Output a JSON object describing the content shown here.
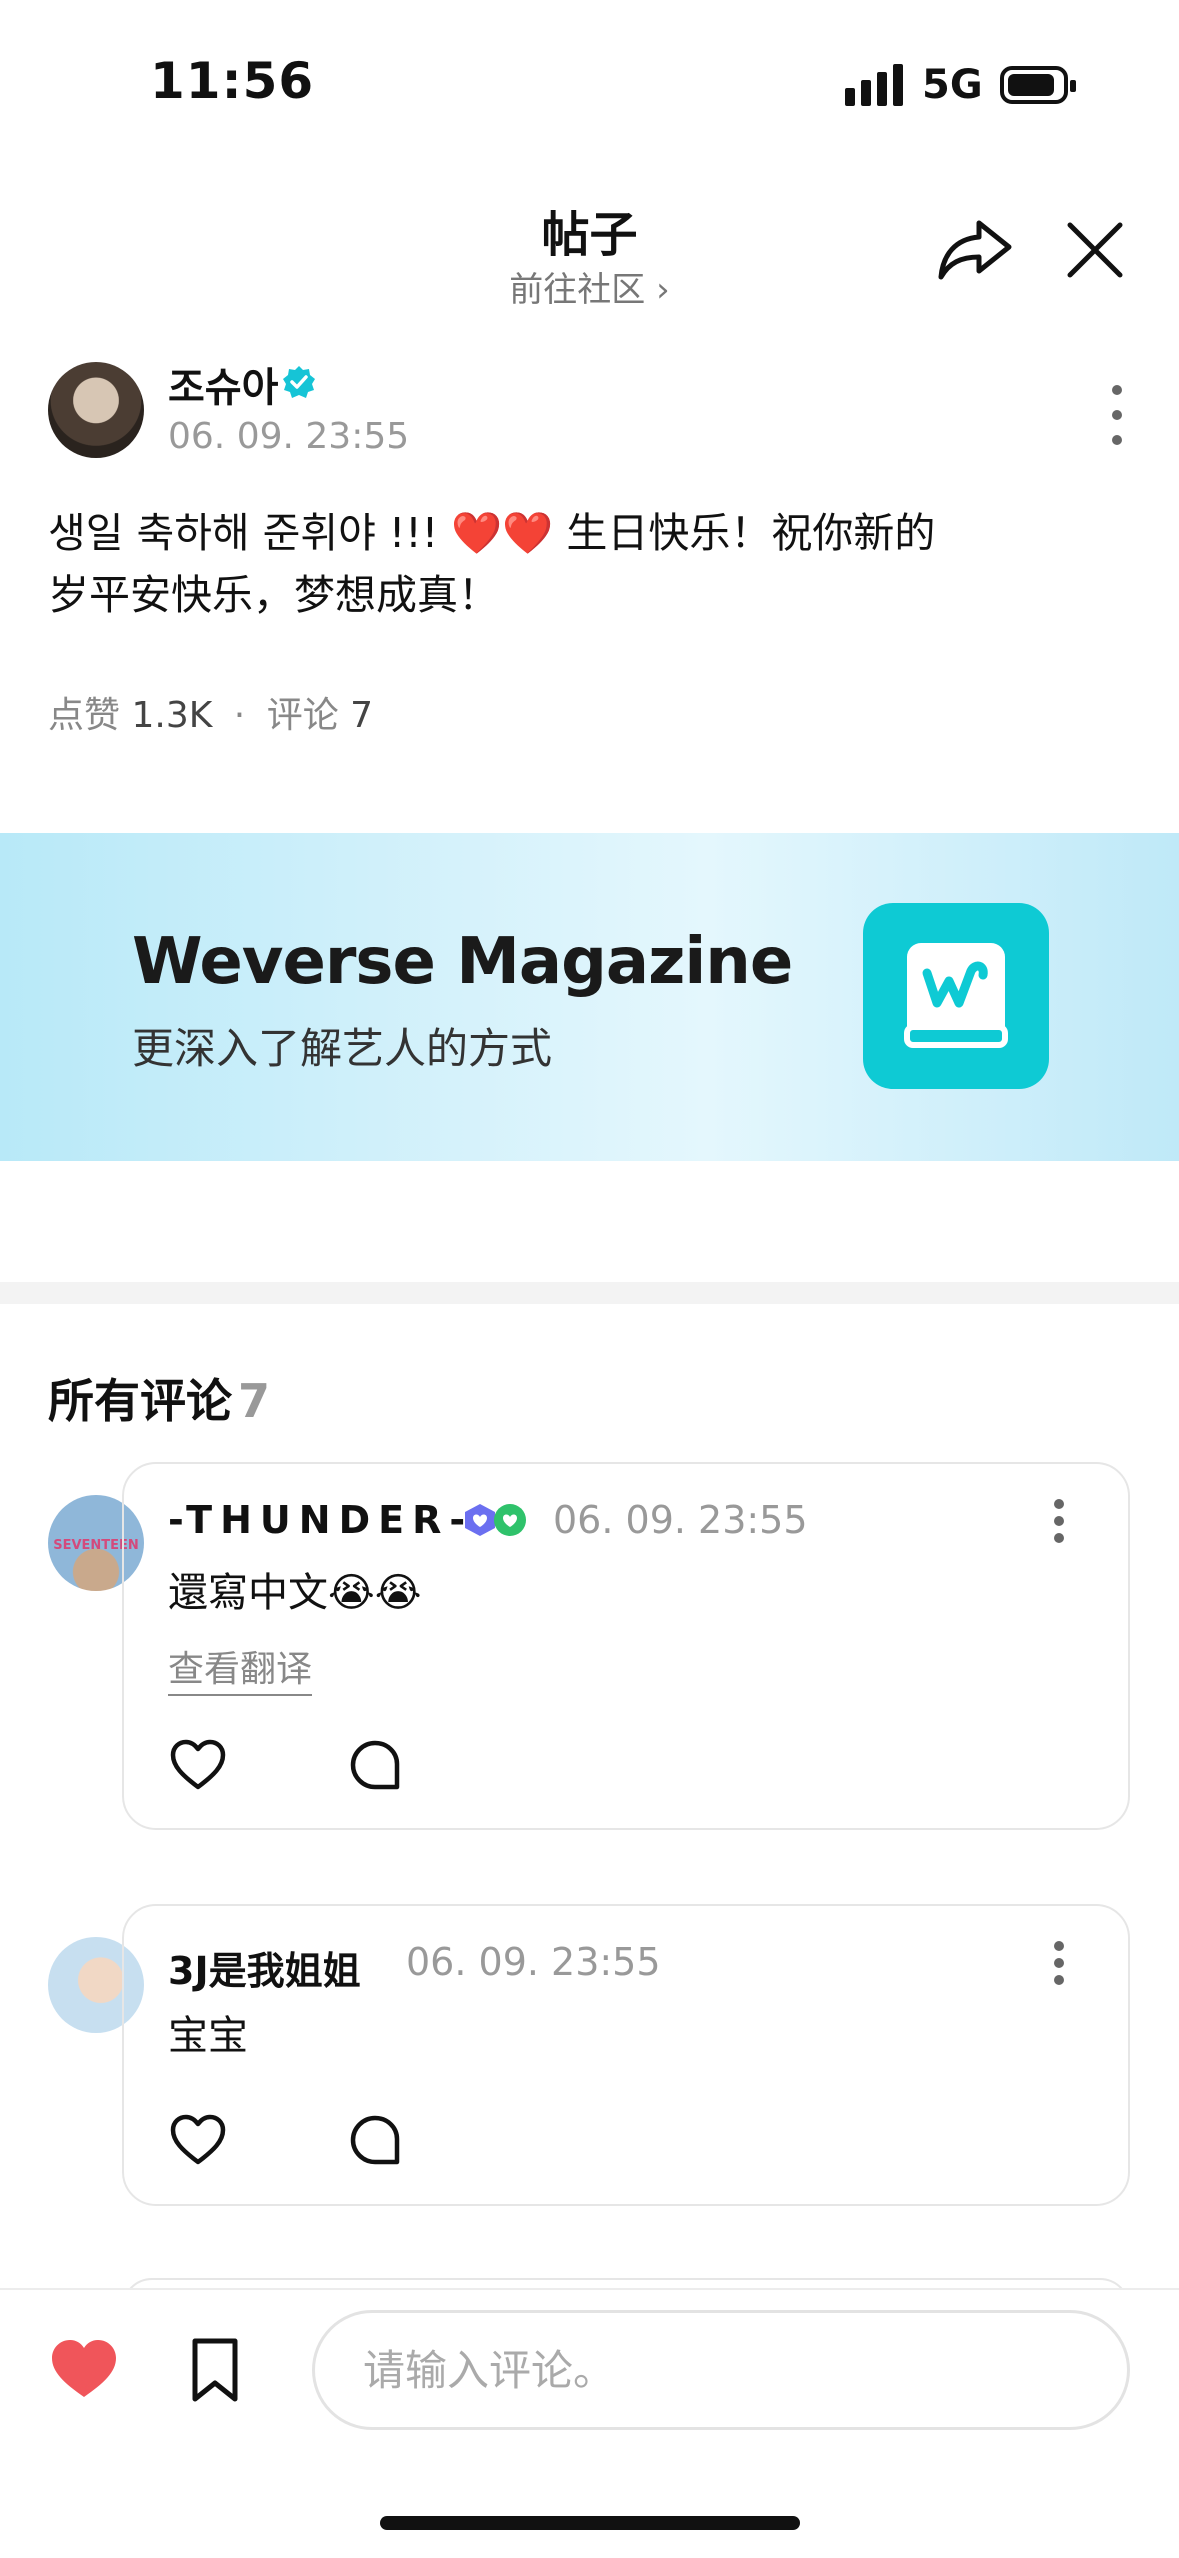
{
  "status_bar": {
    "time": "11:56",
    "network": "5G"
  },
  "header": {
    "title": "帖子",
    "subtitle": "前往社区",
    "share_icon": "share-icon",
    "close_icon": "close-icon"
  },
  "post": {
    "author": "조슈아",
    "timestamp": "06. 09. 23:55",
    "text_line1": "생일 축하해 준휘야 !!! ❤️❤️ 生日快乐！祝你新的",
    "text_line2": "岁平安快乐，梦想成真！",
    "likes_label": "点赞",
    "likes_value": "1.3K",
    "separator": "·",
    "comments_label": "评论",
    "comments_value": "7"
  },
  "banner": {
    "title": "Weverse Magazine",
    "subtitle": "更深入了解艺人的方式"
  },
  "comments_section": {
    "title": "所有评论",
    "count": "7",
    "items": [
      {
        "username": "-THUNDER-",
        "timestamp": "06. 09. 23:55",
        "text": "還寫中文😭😭",
        "translate_label": "查看翻译"
      },
      {
        "username": "3J是我姐姐",
        "timestamp": "06. 09. 23:55",
        "text": "宝宝"
      }
    ]
  },
  "bottom_bar": {
    "input_placeholder": "请输入评论。"
  },
  "colors": {
    "accent": "#0ecad4",
    "like_red": "#f0555a",
    "verified_teal": "#16c4d6"
  }
}
